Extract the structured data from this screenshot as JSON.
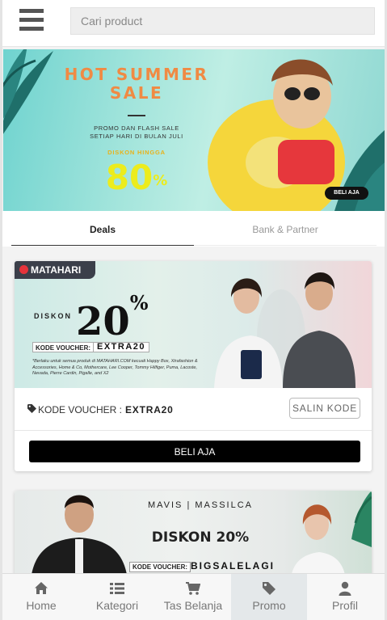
{
  "header": {
    "menu_icon": "hamburger-icon",
    "search_placeholder": "Cari product"
  },
  "hero": {
    "title": "HOT SUMMER SALE",
    "subtitle_line1": "PROMO DAN FLASH SALE",
    "subtitle_line2": "SETIAP HARI DI BULAN JULI",
    "discount_label": "DISKON HINGGA",
    "discount_value": "80",
    "discount_unit": "%",
    "cta": "BELI AJA"
  },
  "tabs": [
    {
      "label": "Deals",
      "active": true
    },
    {
      "label": "Bank & Partner",
      "active": false
    }
  ],
  "promos": [
    {
      "brand": "MATAHARI",
      "banner_diskon": "DISKON",
      "banner_value": "20",
      "banner_unit": "%",
      "banner_voucher_label": "KODE VOUCHER:",
      "banner_voucher_code": "EXTRA20",
      "banner_note": "*Berlaku untuk semua produk di MATAHARI.COM kecuali Happy Box, Xtrafashion & Accessories, Home & Co, Mothercare, Lee Cooper, Tommy Hilfiger, Puma, Lacoste, Nevada, Pierre Cardin, Pigalle, and X2",
      "voucher_label": "KODE VOUCHER :",
      "voucher_code": "EXTRA20",
      "copy_label": "SALIN KODE",
      "buy_label": "BELI AJA"
    },
    {
      "brand": "MAVIS | MASSILCA",
      "banner_diskon": "DISKON 20%",
      "banner_voucher_label": "KODE VOUCHER:",
      "banner_voucher_code": "BIGSALELAGI"
    }
  ],
  "nav": [
    {
      "label": "Home",
      "icon": "home-icon",
      "active": false
    },
    {
      "label": "Kategori",
      "icon": "list-icon",
      "active": false
    },
    {
      "label": "Tas Belanja",
      "icon": "cart-icon",
      "active": false
    },
    {
      "label": "Promo",
      "icon": "tag-icon",
      "active": true
    },
    {
      "label": "Profil",
      "icon": "user-icon",
      "active": false
    }
  ],
  "colors": {
    "hero_title": "#f08a43",
    "hero_discount": "#ecec1c",
    "active_nav_bg": "#e4e8ea",
    "buy_button": "#000000"
  }
}
